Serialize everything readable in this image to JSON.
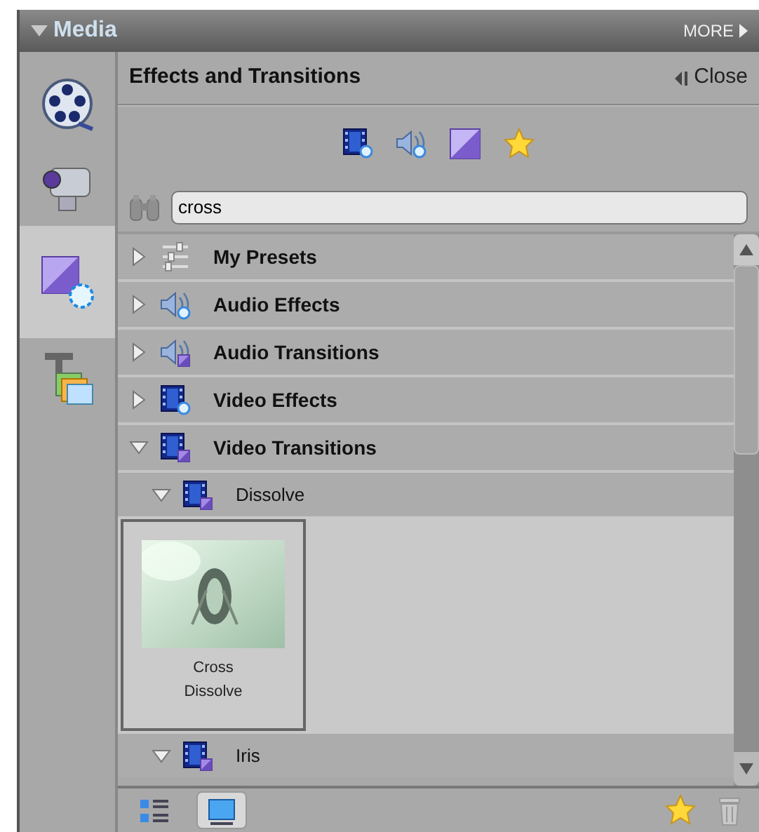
{
  "panel": {
    "title": "Media",
    "more": "MORE"
  },
  "sidebar": [
    {
      "kind": "reel",
      "selected": false
    },
    {
      "kind": "camcorder",
      "selected": false
    },
    {
      "kind": "effects",
      "selected": true
    },
    {
      "kind": "titles",
      "selected": false
    }
  ],
  "effects": {
    "title": "Effects and Transitions",
    "close": "Close",
    "filters": [
      {
        "kind": "video"
      },
      {
        "kind": "audio"
      },
      {
        "kind": "transition"
      },
      {
        "kind": "favorite"
      }
    ],
    "search": {
      "value": "cross"
    },
    "tree": [
      {
        "label": "My Presets",
        "kind": "presets",
        "expanded": false
      },
      {
        "label": "Audio Effects",
        "kind": "audio-effect",
        "expanded": false
      },
      {
        "label": "Audio Transitions",
        "kind": "audio-transition",
        "expanded": false
      },
      {
        "label": "Video Effects",
        "kind": "video-effect",
        "expanded": false
      },
      {
        "label": "Video Transitions",
        "kind": "video-transition",
        "expanded": true,
        "children": [
          {
            "label": "Dissolve",
            "kind": "video-transition",
            "expanded": true,
            "items": [
              {
                "label": "Cross Dissolve",
                "selected": true
              }
            ]
          },
          {
            "label": "Iris",
            "kind": "video-transition",
            "expanded": true
          }
        ]
      }
    ]
  },
  "bottom_bar": {
    "views": [
      {
        "kind": "list",
        "selected": false
      },
      {
        "kind": "thumbnail",
        "selected": true
      }
    ],
    "actions": [
      {
        "kind": "favorite"
      },
      {
        "kind": "delete"
      }
    ]
  }
}
